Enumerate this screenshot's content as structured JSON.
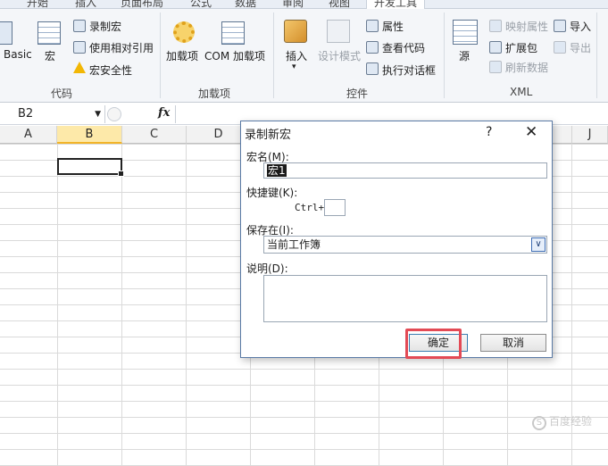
{
  "ribbon": {
    "tabs": [
      "开始",
      "插入",
      "页面布局",
      "公式",
      "数据",
      "审阅",
      "视图",
      "开发工具"
    ],
    "code_group": {
      "label": "代码",
      "basic": "Basic",
      "macros": "宏",
      "record_macro": "录制宏",
      "relative_ref": "使用相对引用",
      "macro_security": "宏安全性"
    },
    "addins_group": {
      "label": "加载项",
      "addins": "加载项",
      "com_addins": "COM 加载项"
    },
    "controls_group": {
      "label": "控件",
      "insert": "插入",
      "design_mode": "设计模式",
      "properties": "属性",
      "view_code": "查看代码",
      "run_dialog": "执行对话框"
    },
    "xml_group": {
      "label": "XML",
      "source": "源",
      "map_properties": "映射属性",
      "expansion_packs": "扩展包",
      "refresh_data": "刷新数据",
      "import": "导入",
      "export": "导出"
    }
  },
  "formula_bar": {
    "name_box": "B2",
    "fx": "fx"
  },
  "sheet": {
    "columns": [
      "A",
      "B",
      "C",
      "D",
      "J"
    ]
  },
  "dialog": {
    "title": "录制新宏",
    "help": "?",
    "close": "✕",
    "macro_name_label": "宏名(M):",
    "macro_name_value": "宏1",
    "shortcut_label": "快捷键(K):",
    "ctrl_label": "Ctrl+",
    "store_in_label": "保存在(I):",
    "store_in_value": "当前工作簿",
    "description_label": "说明(D):",
    "ok": "确定",
    "cancel": "取消"
  },
  "watermark": "百度经验"
}
